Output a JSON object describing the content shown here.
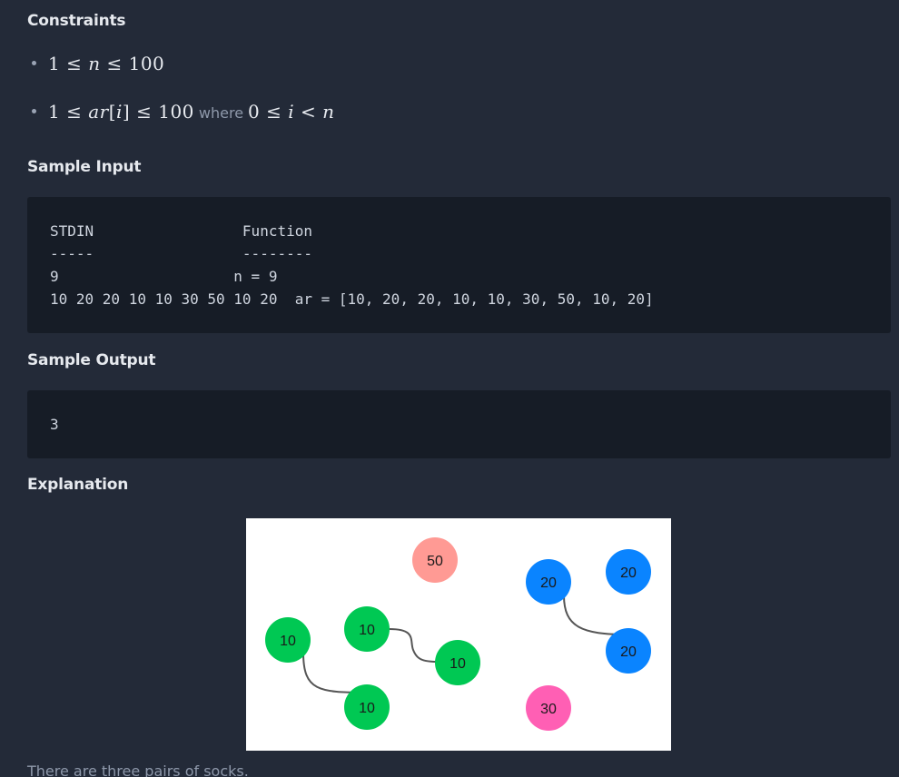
{
  "headings": {
    "constraints": "Constraints",
    "sample_input": "Sample Input",
    "sample_output": "Sample Output",
    "explanation": "Explanation"
  },
  "constraints": {
    "c1": {
      "lower": "1",
      "rel1": "≤",
      "var": "n",
      "rel2": "≤",
      "upper": "100"
    },
    "c2": {
      "lower": "1",
      "rel1": "≤",
      "var_a": "ar",
      "bracket_open": "[",
      "var_i": "i",
      "bracket_close": "]",
      "rel2": "≤",
      "upper": "100",
      "where": "where",
      "w_lower": "0",
      "w_rel1": "≤",
      "w_var": "i",
      "w_rel2": "<",
      "w_upper": "n"
    }
  },
  "sample_input": {
    "lines": [
      "STDIN                 Function",
      "-----                 --------",
      "9                    n = 9",
      "10 20 20 10 10 30 50 10 20  ar = [10, 20, 20, 10, 10, 30, 50, 10, 20]"
    ]
  },
  "sample_output": {
    "lines": [
      "3"
    ]
  },
  "explanation_image": {
    "socks": [
      {
        "label": "10",
        "color": "#00c853"
      },
      {
        "label": "10",
        "color": "#00c853"
      },
      {
        "label": "10",
        "color": "#00c853"
      },
      {
        "label": "10",
        "color": "#00c853"
      },
      {
        "label": "50",
        "color": "#ff9a94"
      },
      {
        "label": "20",
        "color": "#0a84ff"
      },
      {
        "label": "20",
        "color": "#0a84ff"
      },
      {
        "label": "20",
        "color": "#0a84ff"
      },
      {
        "label": "30",
        "color": "#ff5fb4"
      }
    ],
    "connector_color": "#555555"
  },
  "footer": {
    "text": "There are three pairs of socks."
  }
}
